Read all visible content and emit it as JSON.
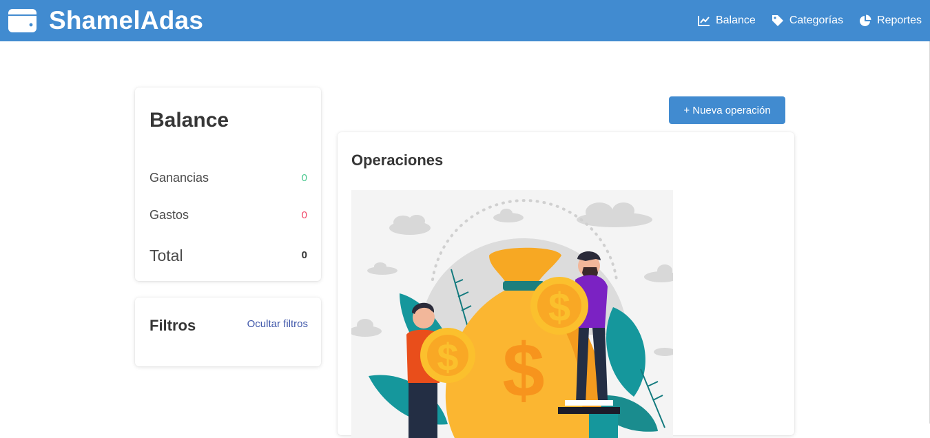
{
  "app": {
    "brand": "ShamelAdas",
    "brand_icon": "wallet-icon",
    "accent_color": "#418bd0"
  },
  "nav": {
    "items": [
      {
        "label": "Balance",
        "icon": "chart-line-icon"
      },
      {
        "label": "Categorías",
        "icon": "tag-icon"
      },
      {
        "label": "Reportes",
        "icon": "pie-chart-icon"
      }
    ]
  },
  "balance": {
    "title": "Balance",
    "earnings_label": "Ganancias",
    "earnings_value": "0",
    "expenses_label": "Gastos",
    "expenses_value": "0",
    "total_label": "Total",
    "total_value": "0",
    "earnings_color": "#48c78e",
    "expenses_color": "#f14668"
  },
  "filters": {
    "title": "Filtros",
    "toggle_label": "Ocultar filtros"
  },
  "operations": {
    "new_button_label": "+ Nueva operación",
    "title": "Operaciones",
    "illustration": "money-bag-illustration"
  }
}
